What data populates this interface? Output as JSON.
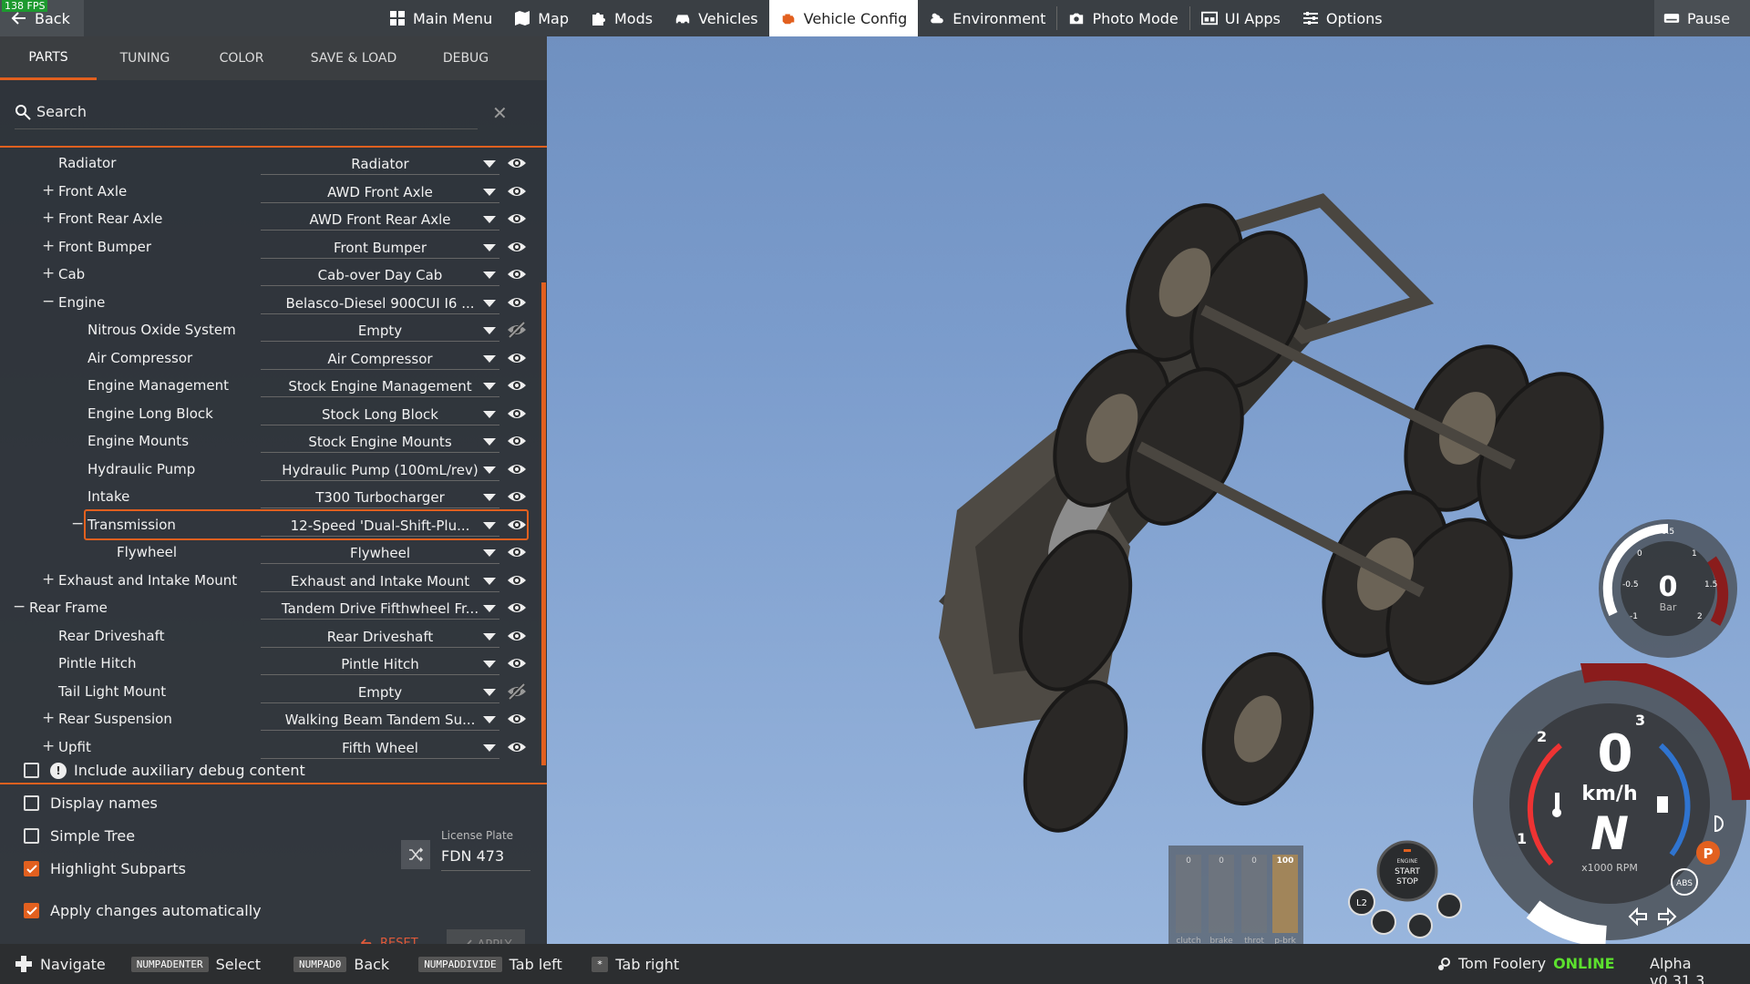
{
  "fps": "138 FPS",
  "topbar": {
    "back_label": "Back",
    "nav": [
      {
        "label": "Main Menu",
        "icon": "main-menu-icon",
        "active": false
      },
      {
        "label": "Map",
        "icon": "map-icon",
        "active": false
      },
      {
        "label": "Mods",
        "icon": "puzzle-icon",
        "active": false
      },
      {
        "label": "Vehicles",
        "icon": "car-icon",
        "active": false
      },
      {
        "label": "Vehicle Config",
        "icon": "engine-icon",
        "active": true
      },
      {
        "label": "Environment",
        "icon": "weather-icon",
        "active": false
      },
      {
        "label": "Photo Mode",
        "icon": "camera-icon",
        "active": false
      },
      {
        "label": "UI Apps",
        "icon": "ui-apps-icon",
        "active": false
      },
      {
        "label": "Options",
        "icon": "sliders-icon",
        "active": false
      }
    ],
    "pause_label": "Pause"
  },
  "panel": {
    "tabs": [
      {
        "label": "PARTS",
        "active": true
      },
      {
        "label": "TUNING",
        "active": false
      },
      {
        "label": "COLOR",
        "active": false
      },
      {
        "label": "SAVE & LOAD",
        "active": false
      },
      {
        "label": "DEBUG",
        "active": false
      }
    ],
    "search_placeholder": "Search",
    "parts": [
      {
        "name": "Radiator",
        "value": "Radiator",
        "indent": 1,
        "toggle": "",
        "visible": true
      },
      {
        "name": "Front Axle",
        "value": "AWD Front Axle",
        "indent": 1,
        "toggle": "+",
        "visible": true
      },
      {
        "name": "Front Rear Axle",
        "value": "AWD Front Rear Axle",
        "indent": 1,
        "toggle": "+",
        "visible": true
      },
      {
        "name": "Front Bumper",
        "value": "Front Bumper",
        "indent": 1,
        "toggle": "+",
        "visible": true
      },
      {
        "name": "Cab",
        "value": "Cab-over Day Cab",
        "indent": 1,
        "toggle": "+",
        "visible": true
      },
      {
        "name": "Engine",
        "value": "Belasco-Diesel 900CUI I6 ...",
        "indent": 1,
        "toggle": "−",
        "visible": true
      },
      {
        "name": "Nitrous Oxide System",
        "value": "Empty",
        "indent": 2,
        "toggle": "",
        "visible": false
      },
      {
        "name": "Air Compressor",
        "value": "Air Compressor",
        "indent": 2,
        "toggle": "",
        "visible": true
      },
      {
        "name": "Engine Management",
        "value": "Stock Engine Management",
        "indent": 2,
        "toggle": "",
        "visible": true
      },
      {
        "name": "Engine Long Block",
        "value": "Stock Long Block",
        "indent": 2,
        "toggle": "",
        "visible": true
      },
      {
        "name": "Engine Mounts",
        "value": "Stock Engine Mounts",
        "indent": 2,
        "toggle": "",
        "visible": true
      },
      {
        "name": "Hydraulic Pump",
        "value": "Hydraulic Pump (100mL/rev)",
        "indent": 2,
        "toggle": "",
        "visible": true
      },
      {
        "name": "Intake",
        "value": "T300 Turbocharger",
        "indent": 2,
        "toggle": "",
        "visible": true
      },
      {
        "name": "Transmission",
        "value": "12-Speed 'Dual-Shift-Plu...",
        "indent": 2,
        "toggle": "−",
        "visible": true,
        "highlight": true
      },
      {
        "name": "Flywheel",
        "value": "Flywheel",
        "indent": 3,
        "toggle": "",
        "visible": true
      },
      {
        "name": "Exhaust and Intake Mount",
        "value": "Exhaust and Intake Mount",
        "indent": 1,
        "toggle": "+",
        "visible": true
      },
      {
        "name": "Rear Frame",
        "value": "Tandem Drive Fifthwheel Fr...",
        "indent": 0,
        "toggle": "−",
        "visible": true
      },
      {
        "name": "Rear Driveshaft",
        "value": "Rear Driveshaft",
        "indent": 1,
        "toggle": "",
        "visible": true
      },
      {
        "name": "Pintle Hitch",
        "value": "Pintle Hitch",
        "indent": 1,
        "toggle": "",
        "visible": true
      },
      {
        "name": "Tail Light Mount",
        "value": "Empty",
        "indent": 1,
        "toggle": "",
        "visible": false
      },
      {
        "name": "Rear Suspension",
        "value": "Walking Beam Tandem Su...",
        "indent": 1,
        "toggle": "+",
        "visible": true
      },
      {
        "name": "Upfit",
        "value": "Fifth Wheel",
        "indent": 1,
        "toggle": "+",
        "visible": true
      }
    ],
    "options": {
      "aux_debug": {
        "label": "Include auxiliary debug content",
        "checked": false
      },
      "display_names": {
        "label": "Display names",
        "checked": false
      },
      "simple_tree": {
        "label": "Simple Tree",
        "checked": false
      },
      "highlight_subparts": {
        "label": "Highlight Subparts",
        "checked": true
      },
      "apply_auto": {
        "label": "Apply changes automatically",
        "checked": true
      }
    },
    "license_plate": {
      "label": "License Plate",
      "value": "FDN 473"
    },
    "reset_label": "RESET",
    "apply_label": "APPLY"
  },
  "hud": {
    "pedals": [
      {
        "label": "clutch",
        "value": "0",
        "level": 0
      },
      {
        "label": "brake",
        "value": "0",
        "level": 0
      },
      {
        "label": "throt",
        "value": "0",
        "level": 0
      },
      {
        "label": "p-brk",
        "value": "100",
        "level": 1
      }
    ],
    "boost": {
      "value": "0",
      "unit": "Bar",
      "ticks": [
        "-1",
        "-0.5",
        "0",
        "0.5",
        "1",
        "1.5",
        "2"
      ]
    },
    "speedo": {
      "speed": "0",
      "unit": "km/h",
      "gear": "N",
      "rpm_label": "x1000 RPM",
      "rpm_ticks": [
        "1",
        "2",
        "3"
      ]
    },
    "engine_button": {
      "line1": "ENGINE",
      "line2": "START",
      "line3": "STOP"
    },
    "key_l2": "L2",
    "abs_label": "ABS",
    "parking_label": "P"
  },
  "statusbar": {
    "hints": [
      {
        "key": "",
        "label": "Navigate"
      },
      {
        "key": "NUMPADENTER",
        "label": "Select"
      },
      {
        "key": "NUMPAD0",
        "label": "Back"
      },
      {
        "key": "NUMPADDIVIDE",
        "label": "Tab left"
      },
      {
        "key": "*",
        "label": "Tab right"
      }
    ],
    "user": "Tom Foolery",
    "status": "ONLINE",
    "version": "Alpha v0.31.3"
  },
  "colors": {
    "accent": "#e2601f",
    "online": "#5ce02e",
    "panel": "#2c2e30"
  }
}
